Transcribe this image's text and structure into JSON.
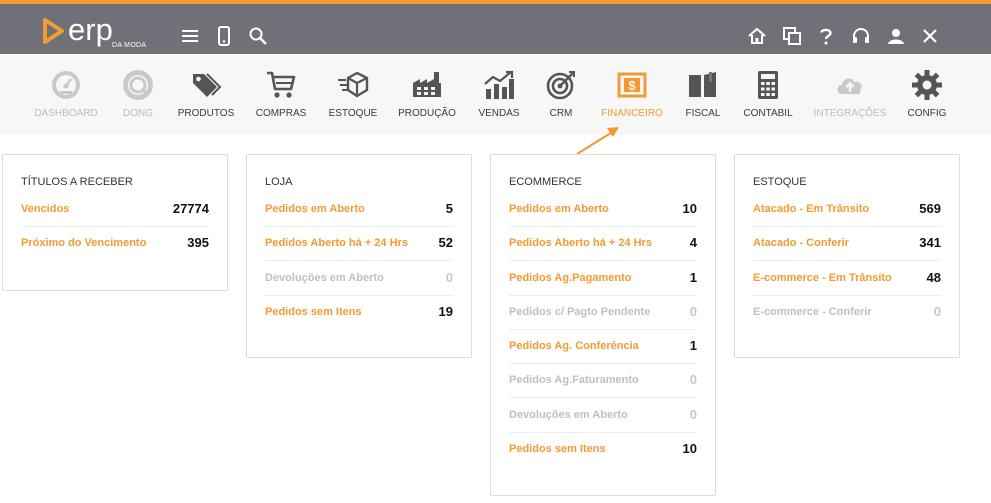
{
  "brand": {
    "logo_text": "erp",
    "logo_subtext": "DA MODA"
  },
  "colors": {
    "accent": "#f39a32",
    "topbar": "#707078",
    "nav_bg": "#f7f7f8",
    "muted": "#c0c0c0"
  },
  "topbar_icons": [
    "menu-icon",
    "mobile-icon",
    "search-icon",
    "home-icon",
    "windows-icon",
    "help-icon",
    "headset-icon",
    "user-icon",
    "close-icon"
  ],
  "modules": [
    {
      "label": "DASHBOARD",
      "icon": "gauge-icon",
      "state": "disabled"
    },
    {
      "label": "DONG",
      "icon": "dong-icon",
      "state": "disabled"
    },
    {
      "label": "PRODUTOS",
      "icon": "tags-icon",
      "state": "normal"
    },
    {
      "label": "COMPRAS",
      "icon": "cart-icon",
      "state": "normal"
    },
    {
      "label": "ESTOQUE",
      "icon": "box-icon",
      "state": "normal"
    },
    {
      "label": "PRODUÇÃO",
      "icon": "factory-icon",
      "state": "normal"
    },
    {
      "label": "VENDAS",
      "icon": "chart-up-icon",
      "state": "normal"
    },
    {
      "label": "CRM",
      "icon": "target-icon",
      "state": "normal"
    },
    {
      "label": "FINANCEIRO",
      "icon": "money-icon",
      "state": "active"
    },
    {
      "label": "FISCAL",
      "icon": "book-icon",
      "state": "normal"
    },
    {
      "label": "CONTABIL",
      "icon": "calculator-icon",
      "state": "normal"
    },
    {
      "label": "INTEGRAÇÕES",
      "icon": "cloud-upload-icon",
      "state": "disabled"
    },
    {
      "label": "CONFIG",
      "icon": "gear-icon",
      "state": "normal"
    }
  ],
  "cards": [
    {
      "title": "TÍTULOS A RECEBER",
      "rows": [
        {
          "label": "Vencidos",
          "value": "27774",
          "muted": false
        },
        {
          "label": "Próximo do Vencimento",
          "value": "395",
          "muted": false
        }
      ]
    },
    {
      "title": "LOJA",
      "rows": [
        {
          "label": "Pedidos em Aberto",
          "value": "5",
          "muted": false
        },
        {
          "label": "Pedidos Aberto há + 24 Hrs",
          "value": "52",
          "muted": false
        },
        {
          "label": "Devoluções em Aberto",
          "value": "0",
          "muted": true
        },
        {
          "label": "Pedidos sem Itens",
          "value": "19",
          "muted": false
        }
      ]
    },
    {
      "title": "ECOMMERCE",
      "rows": [
        {
          "label": "Pedidos em Aberto",
          "value": "10",
          "muted": false
        },
        {
          "label": "Pedidos Aberto há + 24 Hrs",
          "value": "4",
          "muted": false
        },
        {
          "label": "Pedidos Ag.Pagamento",
          "value": "1",
          "muted": false
        },
        {
          "label": "Pedidos c/ Pagto Pendente",
          "value": "0",
          "muted": true
        },
        {
          "label": "Pedidos Ag. Conferência",
          "value": "1",
          "muted": false
        },
        {
          "label": "Pedidos Ag.Faturamento",
          "value": "0",
          "muted": true
        },
        {
          "label": "Devoluções em Aberto",
          "value": "0",
          "muted": true
        },
        {
          "label": "Pedidos sem Itens",
          "value": "10",
          "muted": false
        }
      ]
    },
    {
      "title": "ESTOQUE",
      "rows": [
        {
          "label": "Atacado - Em Trânsito",
          "value": "569",
          "muted": false
        },
        {
          "label": "Atacado - Conferir",
          "value": "341",
          "muted": false
        },
        {
          "label": "E-commerce - Em Trânsito",
          "value": "48",
          "muted": false
        },
        {
          "label": "E-commerce - Conferir",
          "value": "0",
          "muted": true
        }
      ]
    }
  ]
}
